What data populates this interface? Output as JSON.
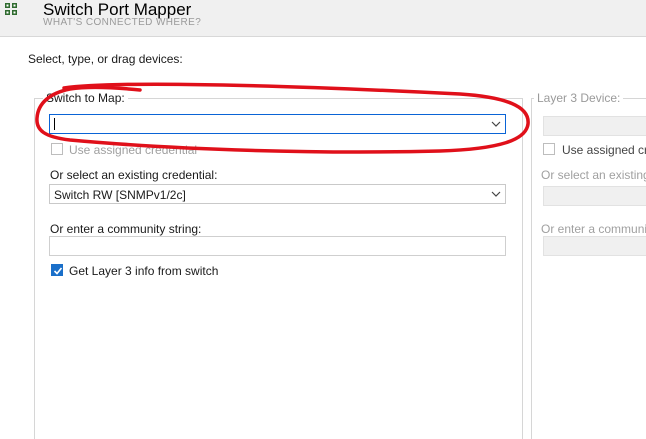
{
  "app": {
    "title": "Switch Port Mapper",
    "subtitle": "WHAT'S CONNECTED WHERE?",
    "icon": "grid-icon"
  },
  "instruction": "Select, type, or drag devices:",
  "left_group": {
    "label": "Switch to Map:",
    "switch_input_value": "",
    "use_assigned_credential_label": "Use assigned credential",
    "use_assigned_credential_checked": false,
    "existing_credential_label": "Or select an existing credential:",
    "existing_credential_value": "Switch RW [SNMPv1/2c]",
    "community_label": "Or enter a community string:",
    "community_value": "",
    "layer3_label": "Get Layer 3 info from switch",
    "layer3_checked": true
  },
  "right_group": {
    "label": "Layer 3 Device:",
    "use_assigned_credential_label": "Use assigned crec",
    "existing_credential_label": "Or select an existing c",
    "community_label": "Or enter a community s"
  },
  "colors": {
    "accent": "#1a6fc9",
    "focus_border": "#0a64d6",
    "annotation": "#e0101a"
  }
}
